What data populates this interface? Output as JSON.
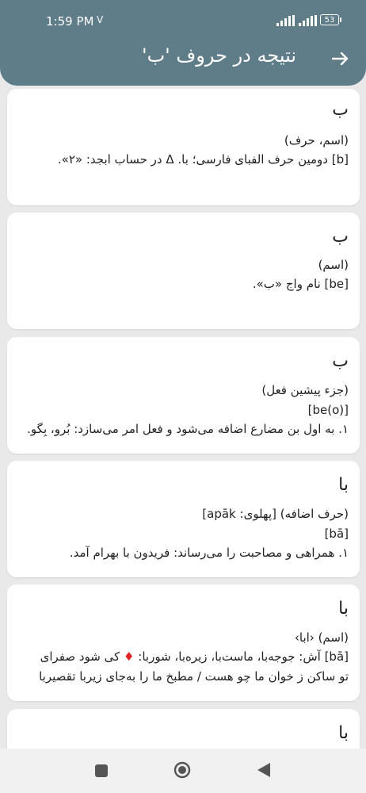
{
  "status_bar": {
    "time": "1:59 PM",
    "indicator": "V",
    "battery": "53"
  },
  "toolbar": {
    "title": "نتیجه در حروف 'ب'",
    "back_icon": "arrow-back-icon"
  },
  "entries": [
    {
      "head": "ب",
      "lines": [
        "(اسم، حرف)",
        "[b] دومین حرف الفبای فارسی؛ با. Δ در حساب ابجد: «۲»."
      ]
    },
    {
      "head": "ب",
      "lines": [
        "(اسم)",
        "[be] نام واج «ب»."
      ]
    },
    {
      "head": "ب",
      "lines": [
        "(جزء پیشین فعل)",
        "[be(o)]",
        "۱. به اول بن مضارع اضافه می‌شود و فعل امر می‌سازد: بُرو، بِگو."
      ]
    },
    {
      "head": "با",
      "lines": [
        "(حرف اضافه) [پهلوی: apāk]",
        "[bā]",
        "۱. همراهی و مصاحبت را می‌رساند: فریدون با بهرام آمد."
      ]
    },
    {
      "head": "با",
      "lines": [
        "(اسم) ‹ابا›",
        "[bā] آش: جوجه‌با، ماست‌با، زیره‌با، شوربا:",
        "کی شود صفرای",
        "تو ساکن ز خوان ما چو هست / مطبخ ما را به‌جای زیربا تقصیربا"
      ]
    },
    {
      "head": "با",
      "lines": []
    }
  ],
  "navbar": {
    "recents": "square-icon",
    "home": "circle-icon",
    "back": "triangle-back-icon"
  },
  "colors": {
    "appbar": "#5f7c89",
    "background": "#e9e9e9",
    "card": "#ffffff",
    "diamond": "#e32020"
  }
}
